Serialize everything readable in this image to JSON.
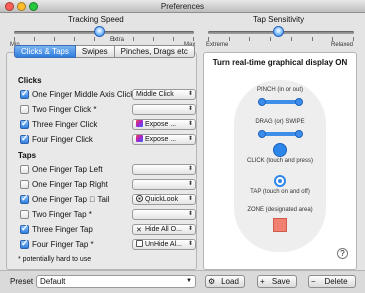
{
  "window": {
    "title": "Preferences"
  },
  "tracking_speed": {
    "title": "Tracking Speed",
    "min_label": "Min",
    "max_label": "Max",
    "extra_label": "Extra",
    "value_fraction": 0.47
  },
  "tap_sensitivity": {
    "title": "Tap Sensitivity",
    "extreme_label": "Extreme",
    "relaxed_label": "Relaxed",
    "value_fraction": 0.48
  },
  "tabs": [
    {
      "label": "Clicks & Taps",
      "selected": true
    },
    {
      "label": "Swipes",
      "selected": false
    },
    {
      "label": "Pinches, Drags etc",
      "selected": false
    }
  ],
  "clicks": {
    "heading": "Clicks",
    "rows": [
      {
        "label": "One Finger Middle Axis Click",
        "checked": true,
        "action": "Middle Click",
        "icon": "none"
      },
      {
        "label": "Two Finger Click *",
        "checked": false,
        "action": "",
        "icon": "none"
      },
      {
        "label": "Three Finger Click",
        "checked": true,
        "action": "Expose ...",
        "icon": "expose-icon"
      },
      {
        "label": "Four Finger Click",
        "checked": true,
        "action": "Expose ...",
        "icon": "expose-icon"
      }
    ]
  },
  "taps": {
    "heading": "Taps",
    "rows": [
      {
        "label": "One Finger Tap Left",
        "checked": false,
        "action": "",
        "icon": "none"
      },
      {
        "label": "One Finger Tap Right",
        "checked": false,
        "action": "",
        "icon": "none"
      },
      {
        "label": "One Finger Tap  Tail",
        "checked": true,
        "action": "QuickLook",
        "icon": "eye-icon"
      },
      {
        "label": "Two Finger Tap *",
        "checked": false,
        "action": "",
        "icon": "none"
      },
      {
        "label": "Three Finger Tap",
        "checked": true,
        "action": "Hide All O...",
        "icon": "x-icon"
      },
      {
        "label": "Four Finger Tap *",
        "checked": true,
        "action": "UnHide Al...",
        "icon": "unhide-icon"
      }
    ]
  },
  "note": "* potentially hard to use",
  "display": {
    "title": "Turn real-time graphical display ON",
    "gestures": [
      "PINCH (in or out)",
      "DRAG (or) SWIPE",
      "CLICK (touch and press)",
      "TAP (touch on and off)",
      "ZONE (designated area)"
    ],
    "help_label": "?"
  },
  "footer": {
    "preset_label": "Preset",
    "preset_value": "Default",
    "load_label": "Load",
    "save_label": "Save",
    "delete_label": "Delete"
  },
  "colors": {
    "accent": "#2e86ea",
    "zone": "#f08070"
  }
}
